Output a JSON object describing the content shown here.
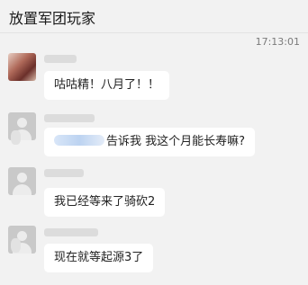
{
  "header": {
    "title": "放置军团玩家"
  },
  "chat": {
    "timestamp": "17:13:01",
    "messages": [
      {
        "text": "咕咕精！八月了！！"
      },
      {
        "text_after_mention": "告诉我 我这个月能长寿嘛?"
      },
      {
        "text": "我已经等来了骑砍2"
      },
      {
        "text": "现在就等起源3了"
      }
    ]
  },
  "colors": {
    "background": "#f2f2f2",
    "bubble": "#ffffff",
    "text": "#222222",
    "timestamp": "#7a7a7a"
  },
  "icons": {
    "avatar_1": "user-photo-avatar",
    "avatar_2": "default-user-avatar",
    "avatar_3": "default-user-avatar",
    "avatar_4": "default-user-avatar"
  }
}
